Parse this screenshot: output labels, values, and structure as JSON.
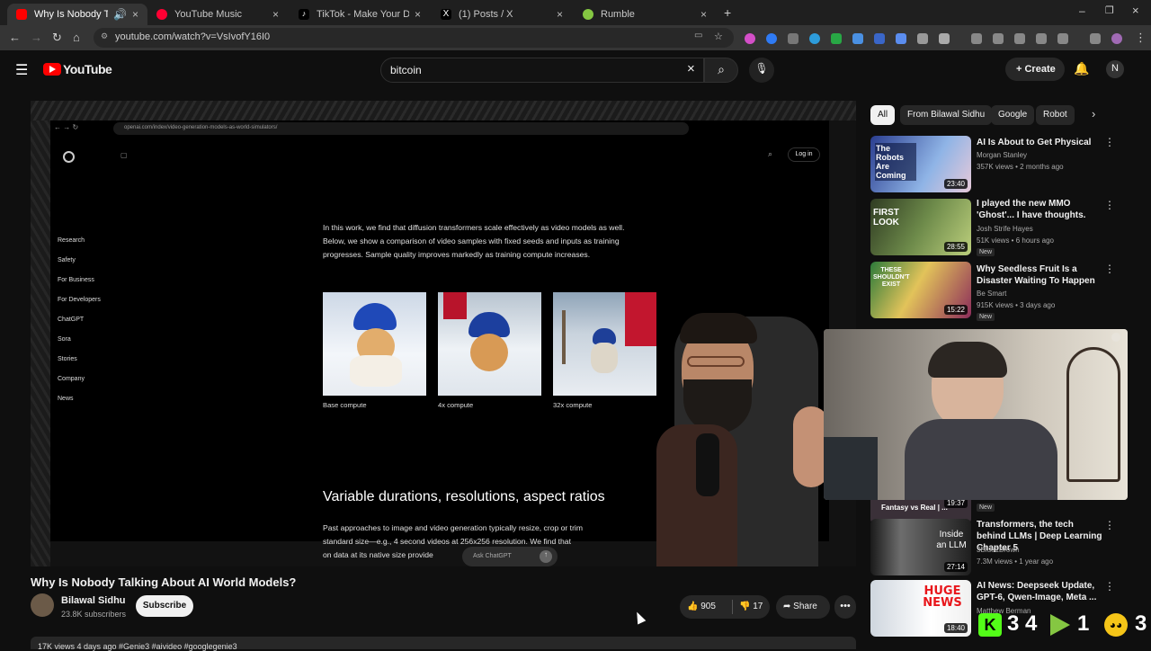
{
  "browser": {
    "tabs": [
      {
        "title": "Why Is Nobody Talking Ab",
        "color": "#ff0000"
      },
      {
        "title": "YouTube Music",
        "color": "#ff0033"
      },
      {
        "title": "TikTok - Make Your Day",
        "color": "#111111"
      },
      {
        "title": "(1) Posts / X",
        "color": "#000000"
      },
      {
        "title": "Rumble",
        "color": "#85c742"
      }
    ],
    "url": "youtube.com/watch?v=VsIvofY16I0"
  },
  "youtube": {
    "logo": "YouTube",
    "search_value": "bitcoin",
    "create_label": "Create",
    "profile_initial": "N"
  },
  "player": {
    "inner_url": "openai.com/index/video-generation-models-as-world-simulators/",
    "login": "Log in",
    "nav": [
      "Research",
      "Safety",
      "For Business",
      "For Developers",
      "ChatGPT",
      "Sora",
      "Stories",
      "Company",
      "News"
    ],
    "para1": [
      "In this work, we find that diffusion transformers scale effectively as video models as well.",
      "Below, we show a comparison of video samples with fixed seeds and inputs as training",
      "progresses. Sample quality improves markedly as training compute increases."
    ],
    "captions": [
      "Base compute",
      "4x compute",
      "32x compute"
    ],
    "heading": "Variable durations, resolutions, aspect ratios",
    "para2": [
      "Past approaches to image and video generation typically resize, crop or trim",
      "standard size—e.g., 4 second videos at 256x256 resolution. We find that",
      "on data at its native size provide"
    ],
    "ask": "Ask ChatGPT"
  },
  "video": {
    "title": "Why Is Nobody Talking About AI World Models?",
    "channel": "Bilawal Sidhu",
    "subscribers": "23.8K subscribers",
    "subscribe": "Subscribe",
    "likes": "905",
    "dislikes": "17",
    "share": "Share",
    "desc": "17K views  4 days ago  #Genie3 #aivideo #googlegenie3"
  },
  "chips": [
    "All",
    "From Bilawal Sidhu",
    "Google",
    "Robot"
  ],
  "recs": [
    {
      "title": "AI Is About to Get Physical",
      "channel": "Morgan Stanley",
      "meta": "357K views • 2 months ago",
      "dur": "23:40",
      "thumb_text": "The Robots Are Coming"
    },
    {
      "title": "I played the new MMO 'Ghost'... I have thoughts.",
      "channel": "Josh Strife Hayes",
      "meta": "51K views • 6 hours ago",
      "dur": "28:55",
      "badge": "New",
      "thumb_text": "FIRST LOOK"
    },
    {
      "title": "Why Seedless Fruit Is a Disaster Waiting To Happen",
      "channel": "Be Smart",
      "meta": "915K views • 3 days ago",
      "dur": "15:22",
      "badge": "New",
      "thumb_text": "THESE SHOULDN'T EXIST"
    },
    {
      "title": "Transformers, the tech behind LLMs | Deep Learning Chapter 5",
      "channel": "3Blue1Brown",
      "meta": "7.3M views • 1 year ago",
      "dur": "27:14",
      "thumb_text": "Inside an LLM"
    },
    {
      "title": "AI News: Deepseek Update, GPT-6, Qwen-Image, Meta ...",
      "channel": "Matthew Berman",
      "meta": "",
      "dur": "18:40",
      "thumb_text": "HUGE NEWS"
    }
  ],
  "hidden_rec": {
    "channel": "Fantasy vs Real | ...",
    "dur": "19:37",
    "badge": "New"
  },
  "overlay": {
    "k": "3",
    "k2": "4",
    "r": "1",
    "g": "3"
  }
}
